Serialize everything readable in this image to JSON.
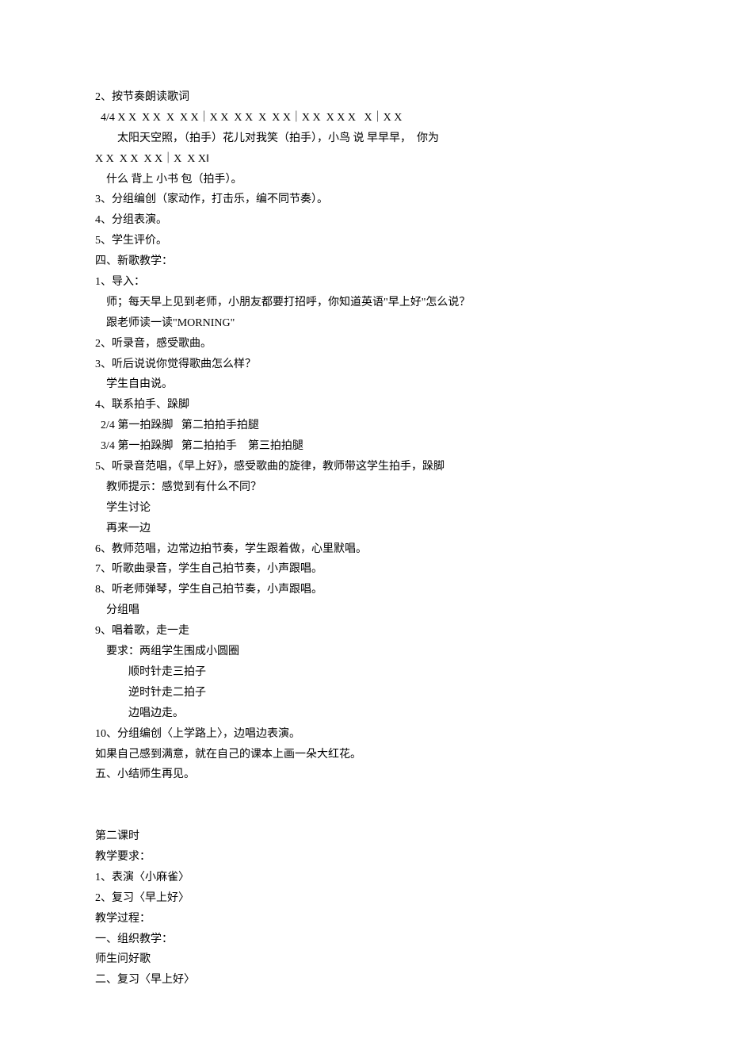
{
  "lines": [
    {
      "cls": "",
      "text": "2、按节奏朗读歌词"
    },
    {
      "cls": "indent-1",
      "text": "4/4 X X  X X  X  X X｜X X  X X  X  X X｜X X  X X X   X｜X X"
    },
    {
      "cls": "indent-3",
      "text": "太阳天空照，（拍手）花儿对我笑（拍手），小鸟 说 早早早，  你为"
    },
    {
      "cls": "",
      "text": "X X  X X  X X｜X  X X‖"
    },
    {
      "cls": "indent-2",
      "text": "什么 背上 小书 包（拍手）。"
    },
    {
      "cls": "",
      "text": "3、分组编创（家动作，打击乐，编不同节奏）。"
    },
    {
      "cls": "",
      "text": "4、分组表演。"
    },
    {
      "cls": "",
      "text": "5、学生评价。"
    },
    {
      "cls": "",
      "text": "四、新歌教学："
    },
    {
      "cls": "",
      "text": "1、导入："
    },
    {
      "cls": "indent-2",
      "text": "师；每天早上见到老师，小朋友都要打招呼，你知道英语\"早上好\"怎么说？"
    },
    {
      "cls": "indent-2",
      "text": "跟老师读一读\"MORNING\""
    },
    {
      "cls": "",
      "text": "2、听录音，感受歌曲。"
    },
    {
      "cls": "",
      "text": "3、听后说说你觉得歌曲怎么样？"
    },
    {
      "cls": "indent-2",
      "text": "学生自由说。"
    },
    {
      "cls": "",
      "text": "4、联系拍手、跺脚"
    },
    {
      "cls": "indent-1",
      "text": "2/4 第一拍跺脚   第二拍拍手拍腿"
    },
    {
      "cls": "indent-1",
      "text": "3/4 第一拍跺脚   第二拍拍手    第三拍拍腿"
    },
    {
      "cls": "",
      "text": "5、听录音范唱，《早上好》，感受歌曲的旋律，教师带这学生拍手，跺脚"
    },
    {
      "cls": "indent-2",
      "text": "教师提示：感觉到有什么不同？"
    },
    {
      "cls": "indent-2",
      "text": "学生讨论"
    },
    {
      "cls": "indent-2",
      "text": "再来一边"
    },
    {
      "cls": "",
      "text": "6、教师范唱，边常边拍节奏，学生跟着做，心里默唱。"
    },
    {
      "cls": "",
      "text": "7、听歌曲录音，学生自己拍节奏，小声跟唱。"
    },
    {
      "cls": "",
      "text": "8、听老师弹琴，学生自己拍节奏，小声跟唱。"
    },
    {
      "cls": "indent-2",
      "text": "分组唱"
    },
    {
      "cls": "",
      "text": "9、唱着歌，走一走"
    },
    {
      "cls": "indent-2",
      "text": "要求：两组学生围成小圆圈"
    },
    {
      "cls": "indent-4",
      "text": "顺时针走三拍子"
    },
    {
      "cls": "indent-4",
      "text": "逆时针走二拍子"
    },
    {
      "cls": "indent-4",
      "text": "边唱边走。"
    },
    {
      "cls": "",
      "text": "10、分组编创〈上学路上〉，边唱边表演。"
    },
    {
      "cls": "",
      "text": "如果自己感到满意，就在自己的课本上画一朵大红花。"
    },
    {
      "cls": "",
      "text": "五、小结师生再见。"
    },
    {
      "cls": "gap",
      "text": ""
    },
    {
      "cls": "gap",
      "text": ""
    },
    {
      "cls": "",
      "text": "第二课时"
    },
    {
      "cls": "",
      "text": "教学要求："
    },
    {
      "cls": "",
      "text": "1、表演〈小麻雀〉"
    },
    {
      "cls": "",
      "text": "2、复习〈早上好〉"
    },
    {
      "cls": "",
      "text": "教学过程："
    },
    {
      "cls": "",
      "text": "一、组织教学："
    },
    {
      "cls": "",
      "text": "师生问好歌"
    },
    {
      "cls": "",
      "text": "二、复习〈早上好〉"
    }
  ]
}
